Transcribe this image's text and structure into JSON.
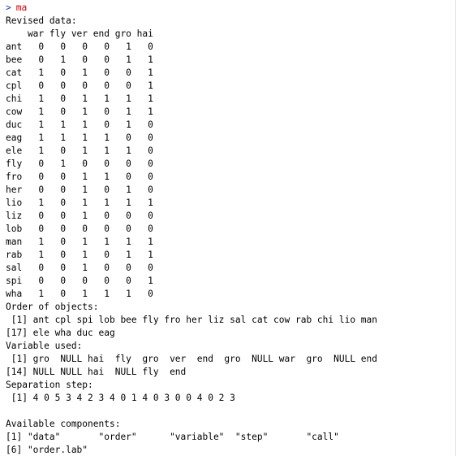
{
  "console": {
    "prompt_symbol": ">",
    "command": "ma",
    "output_lines": [
      "Revised data:",
      "    war fly ver end gro hai",
      "ant   0   0   0   0   1   0",
      "bee   0   1   0   0   1   1",
      "cat   1   0   1   0   0   1",
      "cpl   0   0   0   0   0   1",
      "chi   1   0   1   1   1   1",
      "cow   1   0   1   0   1   1",
      "duc   1   1   1   0   1   0",
      "eag   1   1   1   1   0   0",
      "ele   1   0   1   1   1   0",
      "fly   0   1   0   0   0   0",
      "fro   0   0   1   1   0   0",
      "her   0   0   1   0   1   0",
      "lio   1   0   1   1   1   1",
      "liz   0   0   1   0   0   0",
      "lob   0   0   0   0   0   0",
      "man   1   0   1   1   1   1",
      "rab   1   0   1   0   1   1",
      "sal   0   0   1   0   0   0",
      "spi   0   0   0   0   0   1",
      "wha   1   0   1   1   1   0",
      "Order of objects:",
      " [1] ant cpl spi lob bee fly fro her liz sal cat cow rab chi lio man",
      "[17] ele wha duc eag",
      "Variable used:",
      " [1] gro  NULL hai  fly  gro  ver  end  gro  NULL war  gro  NULL end",
      "[14] NULL NULL hai  NULL fly  end",
      "Separation step:",
      " [1] 4 0 5 3 4 2 3 4 0 1 4 0 3 0 0 4 0 2 3",
      "",
      "Available components:",
      "[1] \"data\"       \"order\"      \"variable\"  \"step\"       \"call\"",
      "[6] \"order.lab\""
    ]
  },
  "colors": {
    "prompt_command": "#c5060b",
    "prompt_caret": "#1f3a9e",
    "output_text": "#000000",
    "background": "#ffffff"
  }
}
